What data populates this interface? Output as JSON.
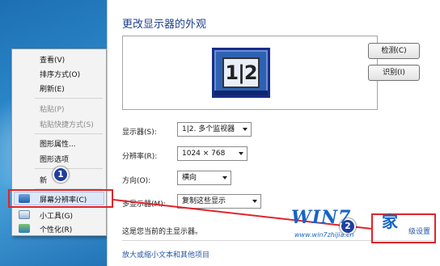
{
  "context_menu": {
    "items": [
      {
        "label": "查看(V)",
        "disabled": false
      },
      {
        "label": "排序方式(O)",
        "disabled": false
      },
      {
        "label": "刷新(E)",
        "disabled": false
      },
      {
        "label": "粘贴(P)",
        "disabled": true
      },
      {
        "label": "粘贴快捷方式(S)",
        "disabled": true
      },
      {
        "label": "图形属性...",
        "disabled": false
      },
      {
        "label": "图形选项",
        "disabled": false
      },
      {
        "label": "新",
        "disabled": false
      },
      {
        "label": "屏幕分辨率(C)",
        "disabled": false
      },
      {
        "label": "小工具(G)",
        "disabled": false
      },
      {
        "label": "个性化(R)",
        "disabled": false
      }
    ]
  },
  "dialog": {
    "title": "更改显示器的外观",
    "preview_number": "1|2",
    "detect_button": "检测(C)",
    "identify_button": "识别(I)",
    "display_label": "显示器(S):",
    "display_value": "1|2. 多个监视器",
    "resolution_label": "分辨率(R):",
    "resolution_value": "1024 × 768",
    "orientation_label": "方向(O):",
    "orientation_value": "横向",
    "multi_display_label": "多显示器(M):",
    "multi_display_value": "复制这些显示",
    "primary_text": "这是您当前的主显示器。",
    "advanced_link": "级设置",
    "bottom_link": "放大或缩小文本和其他项目"
  },
  "annotations": {
    "badge1": "1",
    "badge2": "2",
    "highlight_color": "#e0242b"
  },
  "watermark": {
    "logo": "WIN7",
    "jia": "家",
    "url": "www.win7zhijia.cn"
  }
}
